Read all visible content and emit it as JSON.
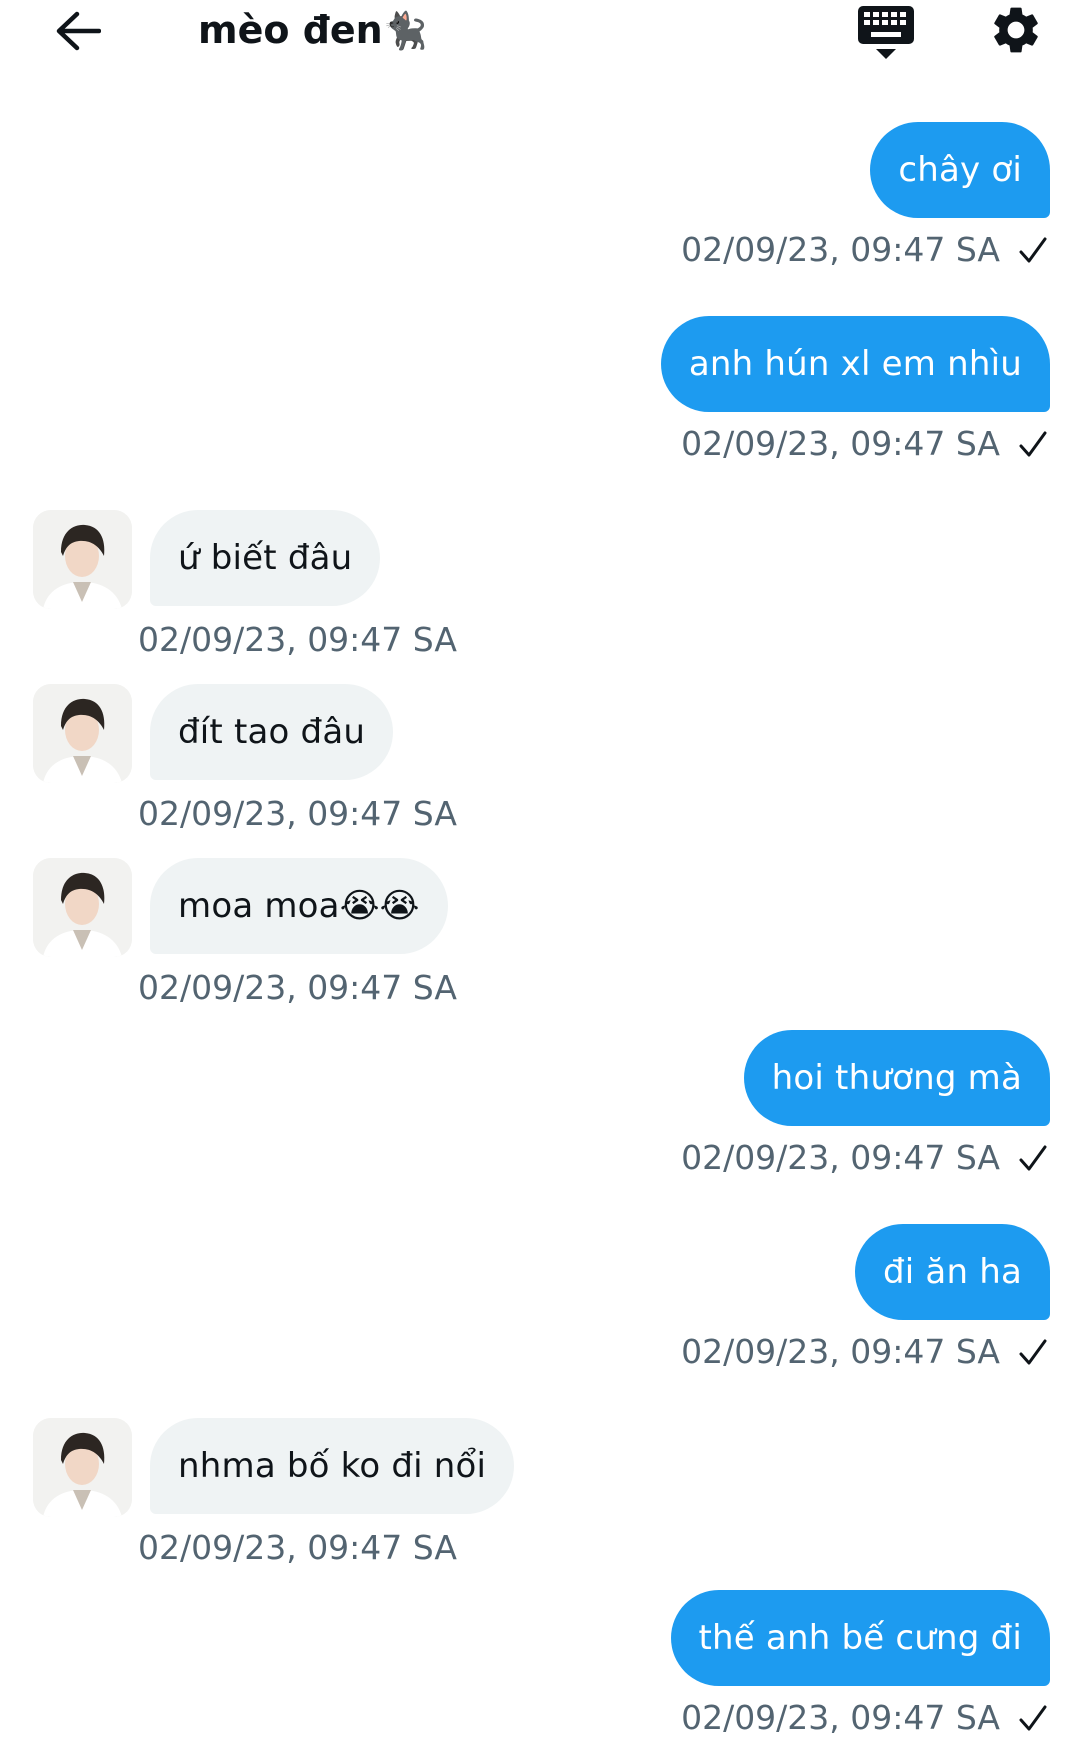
{
  "header": {
    "title": "mèo đen",
    "title_emoji": "🐈‍⬛",
    "back_icon": "arrow-left-icon",
    "keyboard_icon": "keyboard-hide-icon",
    "settings_icon": "gear-icon"
  },
  "colors": {
    "outgoing_bubble": "#1d9bf0",
    "incoming_bubble": "#eff3f4",
    "meta_text": "#536471"
  },
  "messages": [
    {
      "direction": "out",
      "text": "chây ơi",
      "time": "02/09/23, 09:47 SA"
    },
    {
      "direction": "out",
      "text": "anh hún xl em nhìu",
      "time": "02/09/23, 09:47 SA"
    },
    {
      "direction": "in",
      "text": "ứ biết đâu",
      "time": "02/09/23, 09:47 SA"
    },
    {
      "direction": "in",
      "text": "đít tao đâu",
      "time": "02/09/23, 09:47 SA"
    },
    {
      "direction": "in",
      "text": "moa moa😭😭",
      "time": "02/09/23, 09:47 SA"
    },
    {
      "direction": "out",
      "text": "hoi thương mà",
      "time": "02/09/23, 09:47 SA"
    },
    {
      "direction": "out",
      "text": "đi ăn ha",
      "time": "02/09/23, 09:47 SA"
    },
    {
      "direction": "in",
      "text": "nhma bố ko đi nổi",
      "time": "02/09/23, 09:47 SA"
    },
    {
      "direction": "out",
      "text": "thế anh bế cưng đi",
      "time": "02/09/23, 09:47 SA"
    }
  ]
}
